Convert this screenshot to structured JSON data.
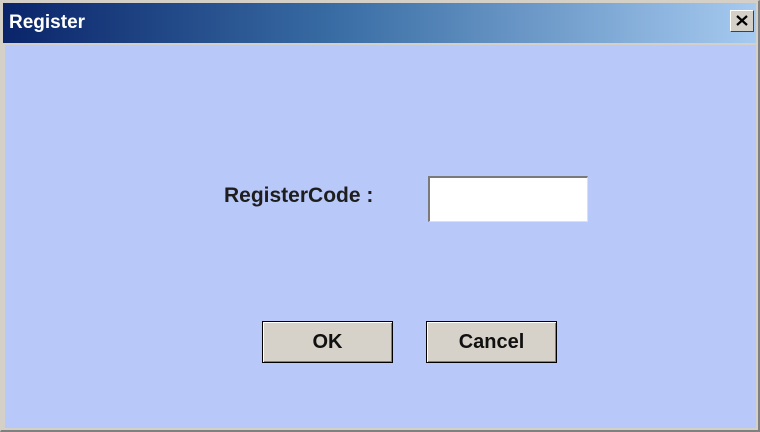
{
  "window": {
    "title": "Register"
  },
  "titlebar": {
    "close_icon": "close-icon"
  },
  "form": {
    "register_code_label": "RegisterCode :",
    "register_code_value": ""
  },
  "buttons": {
    "ok_label": "OK",
    "cancel_label": "Cancel"
  },
  "colors": {
    "client_background": "#b8c8f8",
    "titlebar_start": "#0a246a",
    "titlebar_end": "#a6caf0",
    "button_face": "#d6d2ca"
  }
}
